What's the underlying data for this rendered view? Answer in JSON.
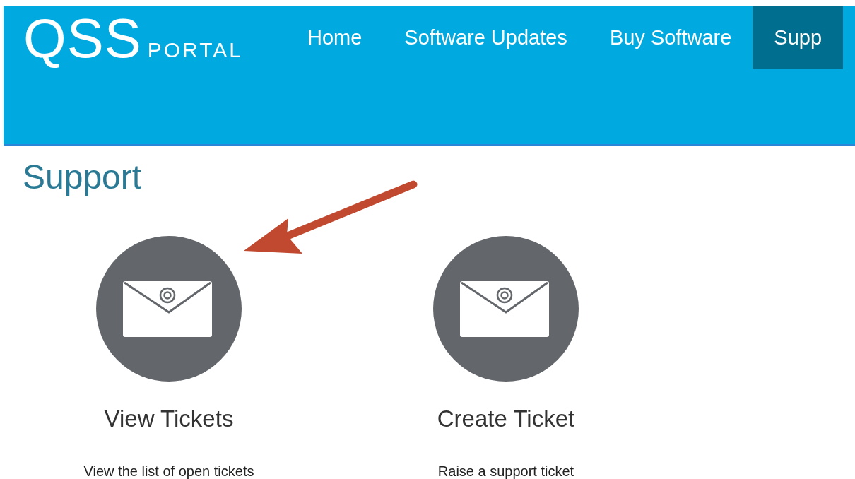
{
  "logo": {
    "mark": "QSS",
    "word": "PORTAL"
  },
  "nav": [
    {
      "label": "Home",
      "selected": false
    },
    {
      "label": "Software Updates",
      "selected": false
    },
    {
      "label": "Buy Software",
      "selected": false
    },
    {
      "label": "Supp",
      "selected": true
    }
  ],
  "page_title": "Support",
  "cards": [
    {
      "title": "View Tickets",
      "description": "View the list of open tickets"
    },
    {
      "title": "Create Ticket",
      "description": "Raise a support ticket"
    }
  ]
}
